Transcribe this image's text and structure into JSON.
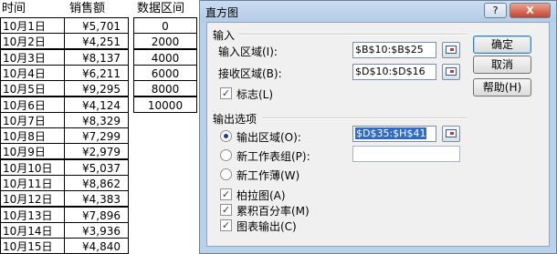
{
  "sheet": {
    "headers": {
      "time": "时间",
      "sales": "销售额",
      "bins": "数据区间"
    },
    "rows": [
      {
        "date": "10月1日",
        "sales": "¥5,701"
      },
      {
        "date": "10月2日",
        "sales": "¥4,251"
      },
      {
        "date": "10月3日",
        "sales": "¥8,137"
      },
      {
        "date": "10月4日",
        "sales": "¥6,211"
      },
      {
        "date": "10月5日",
        "sales": "¥9,295"
      },
      {
        "date": "10月6日",
        "sales": "¥4,124"
      },
      {
        "date": "10月7日",
        "sales": "¥8,329"
      },
      {
        "date": "10月8日",
        "sales": "¥7,299"
      },
      {
        "date": "10月9日",
        "sales": "¥2,979"
      },
      {
        "date": "10月10日",
        "sales": "¥5,037"
      },
      {
        "date": "10月11日",
        "sales": "¥8,862"
      },
      {
        "date": "10月12日",
        "sales": "¥4,383"
      },
      {
        "date": "10月13日",
        "sales": "¥7,896"
      },
      {
        "date": "10月14日",
        "sales": "¥3,936"
      },
      {
        "date": "10月15日",
        "sales": "¥4,840"
      }
    ],
    "bins": [
      "0",
      "2000",
      "4000",
      "6000",
      "8000",
      "10000"
    ]
  },
  "dialog": {
    "title": "直方图",
    "help_label": "?",
    "close_label": "X",
    "input_group": "输入",
    "input_range_label": "输入区域(I):",
    "input_range_value": "$B$10:$B$25",
    "bin_range_label": "接收区域(B):",
    "bin_range_value": "$D$10:$D$16",
    "labels_label": "标志(L)",
    "output_group": "输出选项",
    "output_range_label": "输出区域(O):",
    "output_range_value": "$D$35:$H$41",
    "new_sheet_label": "新工作表组(P):",
    "new_sheet_value": "",
    "new_workbook_label": "新工作薄(W)",
    "pareto_label": "柏拉图(A)",
    "cumulative_label": "累积百分率(M)",
    "chart_output_label": "图表输出(C)",
    "ok_label": "确定",
    "cancel_label": "取消",
    "help_button_label": "帮助(H)",
    "check_mark": "✓",
    "colors": {
      "selection": "#316ac5",
      "frame": "#b9d1ea"
    }
  }
}
